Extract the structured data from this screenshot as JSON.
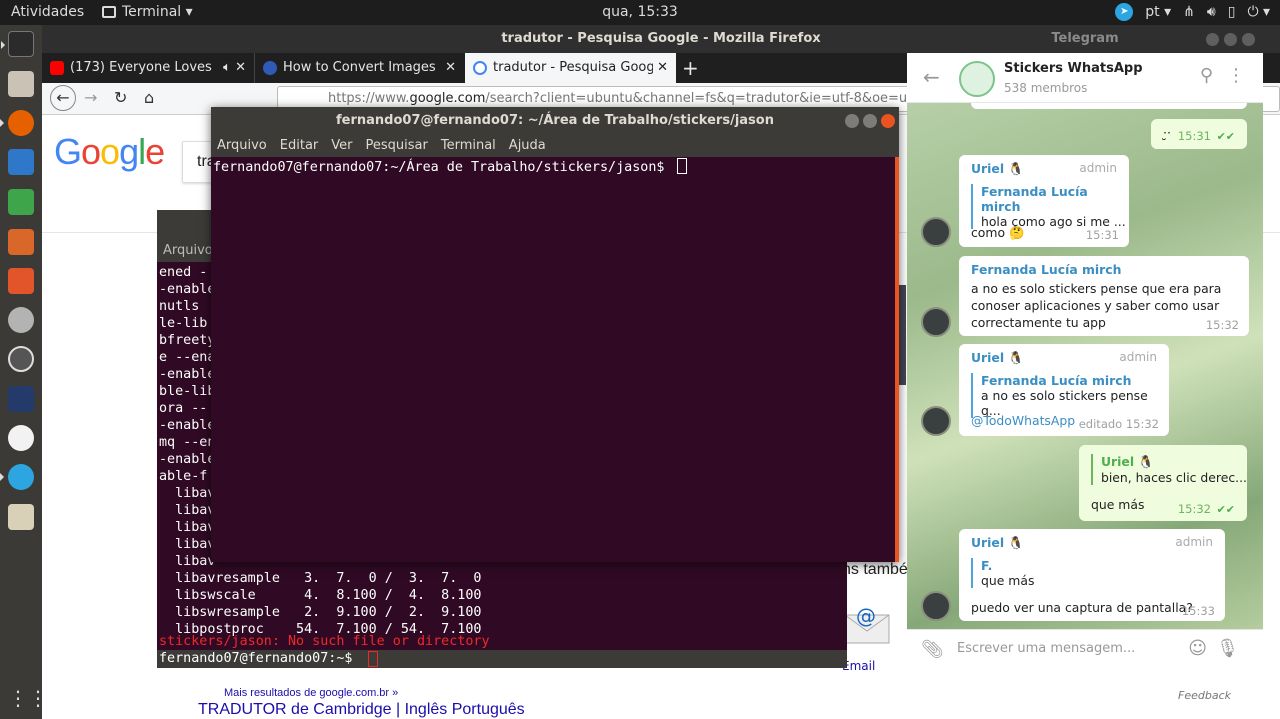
{
  "topbar": {
    "activities": "Atividades",
    "app_name": "Terminal ▾",
    "clock": "qua, 15:33",
    "lang": "pt ▾"
  },
  "firefox": {
    "title": "tradutor - Pesquisa Google - Mozilla Firefox",
    "tabs": [
      {
        "label": "(173) Everyone Loves",
        "icon_color": "#ff0000"
      },
      {
        "label": "How to Convert Images",
        "icon_color": "#2f5bb7"
      },
      {
        "label": "tradutor - Pesquisa Goog",
        "icon_color": "#4285f4"
      }
    ],
    "new_tab": "+",
    "url_prefix": "https://www.",
    "url_domain": "google.com",
    "url_rest": "/search?client=ubuntu&channel=fs&q=tradutor&ie=utf-8&oe=utf-8",
    "search_value": "tra",
    "logo": [
      "G",
      "o",
      "o",
      "g",
      "l",
      "e"
    ],
    "result_title": "TRADUTOR de Cambridge | Inglês Português",
    "more_results": "Mais resultados de google.com.br »",
    "side_text": "ns também",
    "mail_label": "Email",
    "feedback": "Feedback"
  },
  "terminal_back": {
    "menu_label": "Arquivo",
    "lines": [
      "ened -",
      "-enable",
      "nutls",
      "le-lib",
      "bfreety",
      "e --ena",
      "-enable",
      "ble-lib",
      "ora --",
      "-enable",
      "mq --en",
      "-enable",
      "able-f",
      "  libav",
      "  libav",
      "  libav",
      "  libav",
      "  libav",
      "  libavresample   3.  7.  0 /  3.  7.  0",
      "  libswscale      4.  8.100 /  4.  8.100",
      "  libswresample   2.  9.100 /  2.  9.100",
      "  libpostproc    54.  7.100 / 54.  7.100"
    ],
    "error": "stickers/jason: No such file or directory",
    "prompt": "fernando07@fernando07:~$ "
  },
  "terminal_front": {
    "title": "fernando07@fernando07: ~/Área de Trabalho/stickers/jason",
    "menu": [
      "Arquivo",
      "Editar",
      "Ver",
      "Pesquisar",
      "Terminal",
      "Ajuda"
    ],
    "prompt": "fernando07@fernando07:~/Área de Trabalho/stickers/jason$ "
  },
  "telegram": {
    "window_title": "Telegram",
    "chat_name": "Stickers WhatsApp",
    "members": "538 membros",
    "input_placeholder": "Escrever uma mensagem...",
    "messages": [
      {
        "text": "·̮·",
        "time": "15:31"
      },
      {
        "from": "Uriel 🐧",
        "role": "admin",
        "quote_name": "Fernanda Lucía mirch",
        "quote_text": "hola como ago si me ...",
        "text": "como 🤔",
        "time": "15:31"
      },
      {
        "from": "Fernanda Lucía mirch",
        "text": "a no es solo stickers pense que era para conoser aplicaciones y saber como usar correctamente  tu app",
        "time": "15:32"
      },
      {
        "from": "Uriel 🐧",
        "role": "admin",
        "quote_name": "Fernanda Lucía mirch",
        "quote_text": "a no es solo stickers pense q...",
        "text": "@TodoWhatsApp",
        "time": "editado 15:32"
      },
      {
        "from": "Uriel 🐧",
        "quote_text": "bien, haces clic derec...",
        "text": "que más",
        "time": "15:32"
      },
      {
        "from": "Uriel 🐧",
        "role": "admin",
        "quote_name": "F.",
        "quote_text": "que más",
        "text": "puedo ver una captura de pantalla?",
        "time": "15:33"
      }
    ]
  }
}
